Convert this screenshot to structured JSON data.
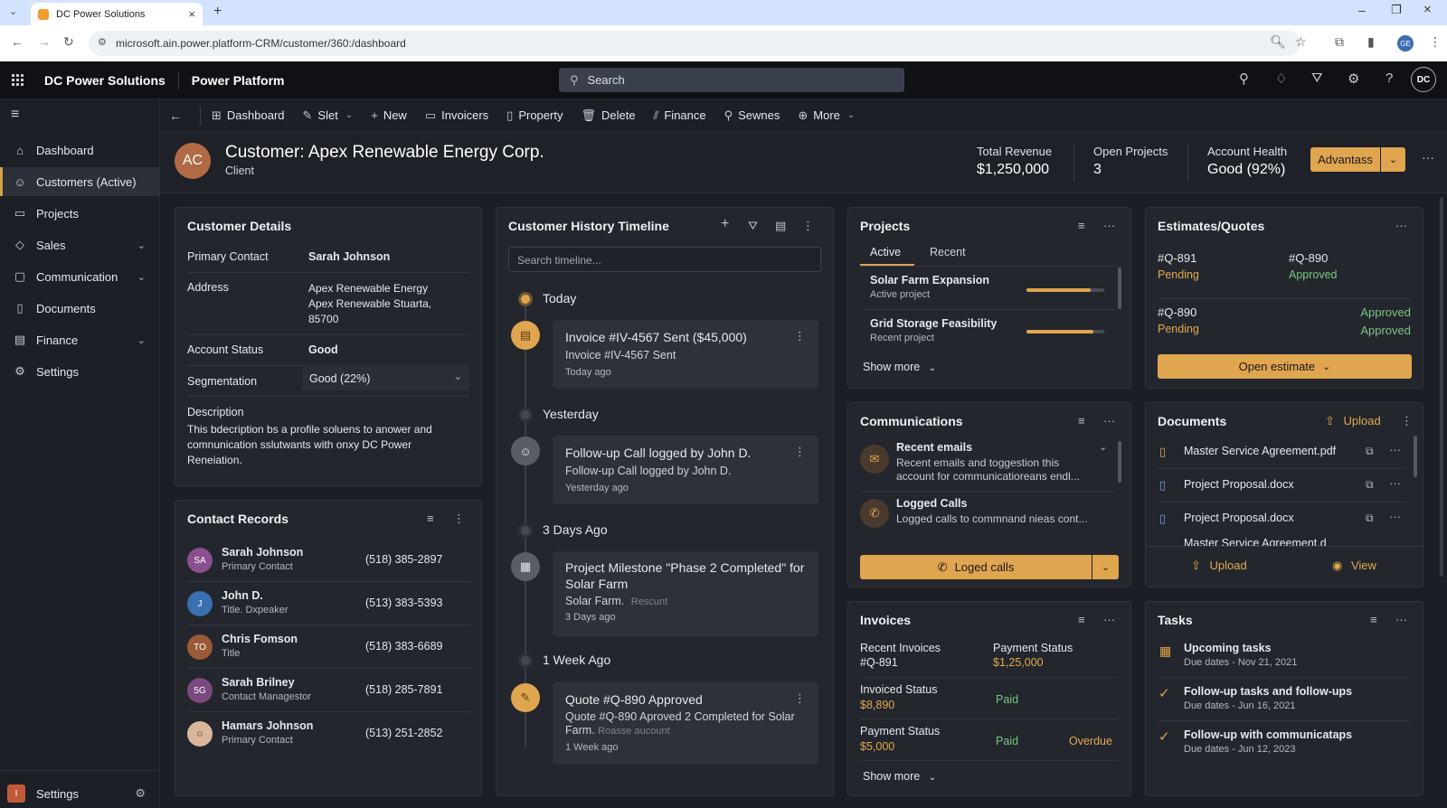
{
  "browser": {
    "tab_title": "DC Power Solutions",
    "url": "microsoft.ain.power.platform-CRM/customer/360:/dashboard"
  },
  "app": {
    "brand": "DC Power Solutions",
    "product": "Power Platform",
    "search_placeholder": "Search",
    "user_initials": "DC"
  },
  "sidebar": {
    "items": [
      {
        "label": "Dashboard",
        "icon": "home-icon"
      },
      {
        "label": "Customers (Active)",
        "icon": "person-icon"
      },
      {
        "label": "Projects",
        "icon": "folder-icon"
      },
      {
        "label": "Sales",
        "icon": "tag-icon"
      },
      {
        "label": "Communication",
        "icon": "chat-icon"
      },
      {
        "label": "Documents",
        "icon": "document-icon"
      },
      {
        "label": "Finance",
        "icon": "money-icon"
      },
      {
        "label": "Settings",
        "icon": "gear-icon"
      }
    ],
    "footer_label": "Settings",
    "footer_badge": "I"
  },
  "commands": [
    "Dashboard",
    "Slet",
    "New",
    "Invoicers",
    "Property",
    "Delete",
    "Finance",
    "Sewnes",
    "More"
  ],
  "customer": {
    "initials": "AC",
    "title": "Customer: Apex Renewable Energy Corp.",
    "subtitle": "Client",
    "metrics": [
      {
        "label": "Total Revenue",
        "value": "$1,250,000"
      },
      {
        "label": "Open Projects",
        "value": "3"
      },
      {
        "label": "Account Health",
        "value": "Good (92%)"
      }
    ],
    "action_button": "Advantass"
  },
  "customer_details": {
    "title": "Customer Details",
    "primary_contact_label": "Primary Contact",
    "primary_contact": "Sarah Johnson",
    "address_label": "Address",
    "address_lines": [
      "Apex Renewable Energy",
      "Apex Renewable Stuarta,",
      "85700"
    ],
    "status_label": "Account Status",
    "status": "Good",
    "segmentation_label": "Segmentation",
    "segmentation": "Good (22%)",
    "description_label": "Description",
    "description": "This bdecription bs a profile soluens to anower and comnunication sslutwants with onxy DC Power Reneiation."
  },
  "contacts": {
    "title": "Contact Records",
    "rows": [
      {
        "initials": "SA",
        "name": "Sarah Johnson",
        "role": "Primary Contact",
        "phone": "(518) 385-2897",
        "color": "#8a4f8e"
      },
      {
        "initials": "J",
        "name": "John D.",
        "role": "Title. Dxpeaker",
        "phone": "(513) 383-5393",
        "color": "#3a6fb0"
      },
      {
        "initials": "TO",
        "name": "Chris Fomson",
        "role": "Title",
        "phone": "(518) 383-6689",
        "color": "#9a5a36"
      },
      {
        "initials": "5G",
        "name": "Sarah Brilney",
        "role": "Contact Managestor",
        "phone": "(518) 285-7891",
        "color": "#7a4a7e"
      },
      {
        "initials": "",
        "name": "Hamars Johnson",
        "role": "Primary Contact",
        "phone": "(513) 251-2852",
        "color": "#d9b79a"
      }
    ]
  },
  "timeline": {
    "title": "Customer History Timeline",
    "search_placeholder": "Search timeline...",
    "groups": [
      {
        "label": "Today",
        "title": "Invoice #IV-4567 Sent ($45,000)",
        "detail": "Invoice #IV-4567 Sent",
        "muted": "",
        "time": "Today ago",
        "icon": "invoice-icon"
      },
      {
        "label": "Yesterday",
        "title": "Follow-up Call logged by John D.",
        "detail": "Follow-up Call logged by John D.",
        "muted": "",
        "time": "Yesterday ago",
        "icon": "person-icon"
      },
      {
        "label": "3 Days Ago",
        "title": "Project Milestone \"Phase 2 Completed\" for Solar Farm",
        "detail": "Solar Farm.",
        "muted": "Rescunt",
        "time": "3 Days ago",
        "icon": "calendar-icon"
      },
      {
        "label": "1 Week Ago",
        "title": "Quote #Q-890 Approved",
        "detail": "Quote #Q-890 Aproved 2 Completed for Solar Farm.",
        "muted": "Roasse aucount",
        "time": "1 Week ago",
        "icon": "quote-icon"
      }
    ]
  },
  "projects": {
    "title": "Projects",
    "tabs": [
      "Active",
      "Recent"
    ],
    "items": [
      {
        "name": "Solar Farm Expansion",
        "status": "Active project",
        "progress": 0.82
      },
      {
        "name": "Grid Storage Feasibility",
        "status": "Recent project",
        "progress": 0.86
      }
    ],
    "show_more": "Show more"
  },
  "communications": {
    "title": "Communications",
    "items": [
      {
        "title": "Recent emails",
        "text": "Recent emails and toggestion this account for communicatioreans endl..."
      },
      {
        "title": "Logged Calls",
        "text": "Logged calls to commnand nieas cont..."
      }
    ],
    "button": "Loged calls"
  },
  "invoices": {
    "title": "Invoices",
    "recent_label": "Recent Invoices",
    "recent_value": "#Q-891",
    "payment_label": "Payment Status",
    "payment_value": "$1,25,000",
    "invoiced_label": "Invoiced Status",
    "invoiced_value": "$8,890",
    "invoiced_status": "Paid",
    "payment2_label": "Payment Status",
    "payment2_value": "$5,000",
    "payment2_status": "Paid",
    "payment2_extra": "Overdue",
    "show_more": "Show more"
  },
  "estimates": {
    "title": "Estimates/Quotes",
    "items": [
      {
        "id": "#Q-891",
        "status": "Pending"
      },
      {
        "id": "#Q-890",
        "status": "Approved"
      },
      {
        "id": "#Q-890",
        "status": "Pending"
      }
    ],
    "approved_1": "Approved",
    "approved_2": "Approved",
    "button": "Open estimate"
  },
  "documents": {
    "title": "Documents",
    "upload": "Upload",
    "files": [
      "Master Service Agreement.pdf",
      "Project Proposal.docx",
      "Project Proposal.docx",
      "Master Service Agreement.d"
    ],
    "footer_upload": "Upload",
    "footer_view": "View"
  },
  "tasks": {
    "title": "Tasks",
    "items": [
      {
        "title": "Upcoming tasks",
        "due": "Due dates - Nov 21, 2021"
      },
      {
        "title": "Follow-up tasks and follow-ups",
        "due": "Due dates - Jun 16, 2021"
      },
      {
        "title": "Follow-up with communicataps",
        "due": "Due dates - Jun 12, 2023"
      }
    ]
  },
  "colors": {
    "accent": "#e0a54f",
    "good": "#7bc57f",
    "bg": "#1b1e24",
    "card": "#23262d"
  }
}
